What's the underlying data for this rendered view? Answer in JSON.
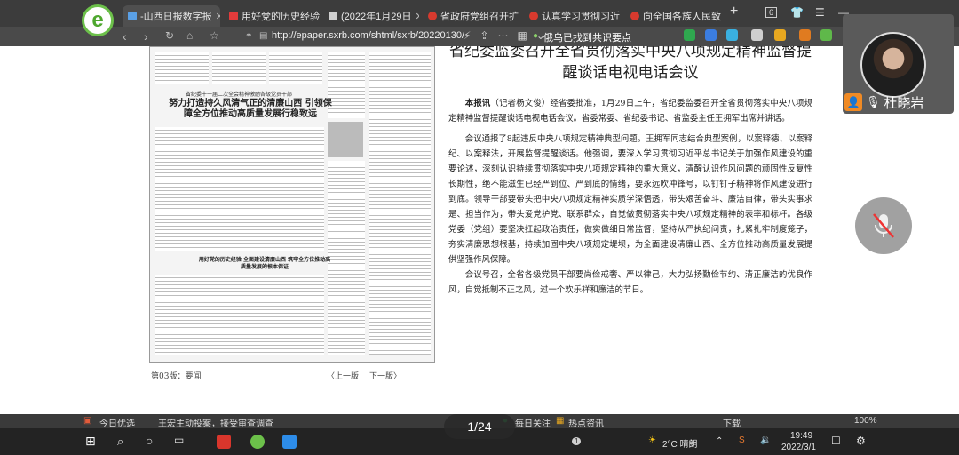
{
  "browser": {
    "tabs": [
      {
        "label": "-山西日报数字报",
        "color": "#5aa0e6",
        "active": true
      },
      {
        "label": "用好党的历史经验",
        "color": "#e23b3b",
        "active": false
      },
      {
        "label": "(2022年1月29日",
        "color": "#cfcfcf",
        "active": false
      },
      {
        "label": "省政府党组召开扩",
        "color": "#d73a2e",
        "active": false
      },
      {
        "label": "认真学习贯彻习近",
        "color": "#d73a2e",
        "active": false
      },
      {
        "label": "向全国各族人民致",
        "color": "#d73a2e",
        "active": false
      }
    ],
    "new_tab": "+",
    "tab_count": "6",
    "url": "http://epaper.sxrb.com/shtml/sxrb/20220130/",
    "hint": "俄乌已找到共识要点"
  },
  "newspaper": {
    "small_head": "省纪委十一届二次全会精神激励各级党员干部",
    "big_head": "努力打造持久风清气正的清廉山西 引领保障全方位推动高质量发展行稳致远",
    "sub_head": "用好党的历史经验 全面建设清廉山西 筑牢全方位推动高质量发展的根本保证",
    "page_label": "第03版：要闻",
    "prev": "〈上一版",
    "next": "下一版〉"
  },
  "article": {
    "title": "省纪委监委召开全省贯彻落实中央八项规定精神监督提醒谈话电视电话会议",
    "lead": "本报讯",
    "p1": "（记者杨文俊）经省委批准，1月29日上午，省纪委监委召开全省贯彻落实中央八项规定精神监督提醒谈话电视电话会议。省委常委、省纪委书记、省监委主任王拥军出席并讲话。",
    "p2": "会议通报了8起违反中央八项规定精神典型问题。王拥军同志结合典型案例，以案释德、以案释纪、以案释法，开展监督提醒谈话。他强调，要深入学习贯彻习近平总书记关于加强作风建设的重要论述，深刻认识持续贯彻落实中央八项规定精神的重大意义，清醒认识作风问题的顽固性反复性长期性，绝不能滋生已经严到位、严到底的情绪，要永远吹冲锋号，以钉钉子精神将作风建设进行到底。领导干部要带头把中央八项规定精神实质学深悟透，带头艰苦奋斗、廉洁自律，带头实事求是、担当作为，带头爱党护党、联系群众，自觉做贯彻落实中央八项规定精神的表率和标杆。各级党委（党组）要坚决扛起政治责任，做实做细日常监督，坚持从严执纪问责，扎紧扎牢制度笼子，夯实清廉思想根基，持续加固中央八项规定堤坝，为全面建设清廉山西、全方位推动高质量发展提供坚强作风保障。",
    "p3": "会议号召，全省各级党员干部要尚俭戒奢、严以律己，大力弘扬勤俭节约、清正廉洁的优良作风，自觉抵制不正之风，过一个欢乐祥和廉洁的节日。"
  },
  "statusbar": {
    "today": "今日优选",
    "news": "王宏主动投案，接受审查调查",
    "weather_feature": "每日关注",
    "hot": "热点资讯",
    "download": "下载",
    "zoom": "100%"
  },
  "meeting": {
    "participant": "杜晓岩",
    "page_indicator": "1/24"
  },
  "taskbar": {
    "weather": "2°C 晴朗",
    "time": "19:49",
    "date": "2022/3/1",
    "notify": "1"
  }
}
